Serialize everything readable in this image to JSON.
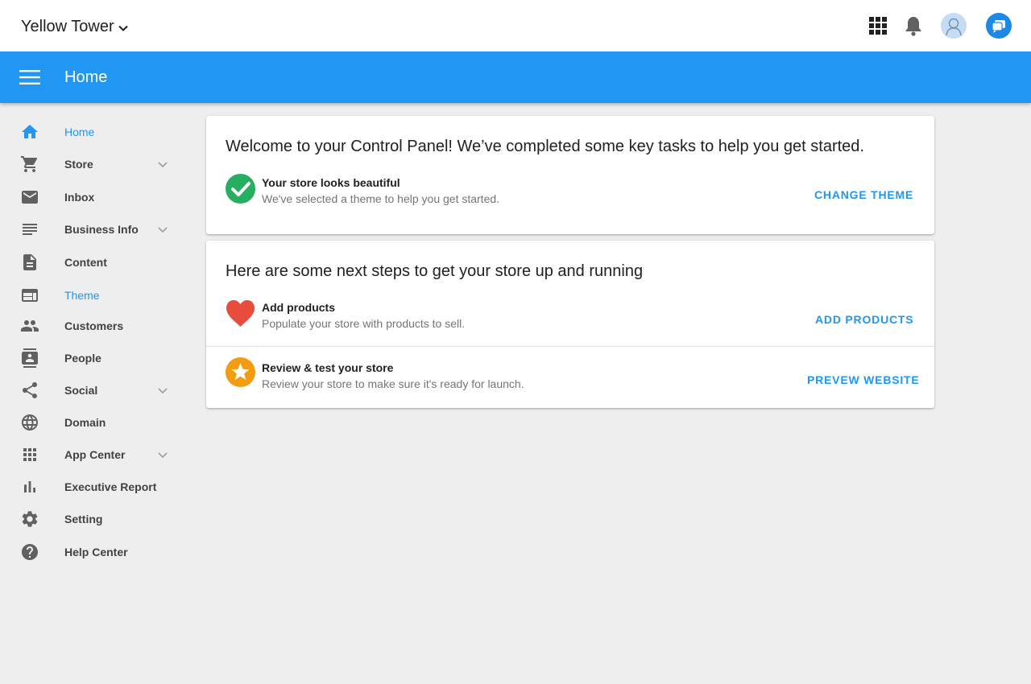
{
  "topbar": {
    "store_name": "Yellow Tower",
    "icons": [
      "chevron-down-icon",
      "apps-grid-icon",
      "bell-icon",
      "avatar",
      "chat-icon"
    ]
  },
  "appbar": {
    "title": "Home",
    "menu_icon": "menu-icon",
    "color": "#2196f3"
  },
  "sidebar": {
    "items": [
      {
        "label": "Home",
        "icon": "home-icon",
        "active": true
      },
      {
        "label": "Store",
        "icon": "cart-icon",
        "expandable": true
      },
      {
        "label": "Inbox",
        "icon": "mail-icon"
      },
      {
        "label": "Business Info",
        "icon": "lines-icon",
        "expandable": true
      },
      {
        "label": "Content",
        "icon": "document-icon"
      },
      {
        "label": "Theme",
        "icon": "browser-window-icon",
        "active": true
      },
      {
        "label": "Customers",
        "icon": "people-icon"
      },
      {
        "label": "People",
        "icon": "contact-card-icon"
      },
      {
        "label": "Social",
        "icon": "share-icon",
        "expandable": true
      },
      {
        "label": "Domain",
        "icon": "globe-icon"
      },
      {
        "label": "App Center",
        "icon": "apps-grid-icon",
        "expandable": true
      },
      {
        "label": "Executive Report",
        "icon": "bar-chart-icon"
      },
      {
        "label": "Setting",
        "icon": "gear-icon"
      },
      {
        "label": "Help Center",
        "icon": "help-icon"
      }
    ]
  },
  "welcome_card": {
    "title": "Welcome to your Control Panel! We’ve completed some key tasks to help you get started.",
    "task": {
      "title": "Your store looks beautiful",
      "desc": "We've selected a theme to help you get started.",
      "action": "CHANGE THEME",
      "icon": "check-circle-icon",
      "icon_color": "#27ae60"
    }
  },
  "next_steps_card": {
    "title": "Here are some next steps to get your store up and running",
    "tasks": [
      {
        "title": "Add products",
        "desc": "Populate your store with products to sell.",
        "action": "ADD PRODUCTS",
        "icon": "heart-icon",
        "icon_color": "#e74c3c"
      },
      {
        "title": "Review & test your store",
        "desc": "Review your store to make sure it's ready for launch.",
        "action": "PREVEW WEBSITE",
        "icon": "star-circle-icon",
        "icon_color": "#f39c12"
      }
    ]
  },
  "colors": {
    "accent": "#2196f3",
    "background": "#eeeeee",
    "nav_text": "#424242"
  }
}
